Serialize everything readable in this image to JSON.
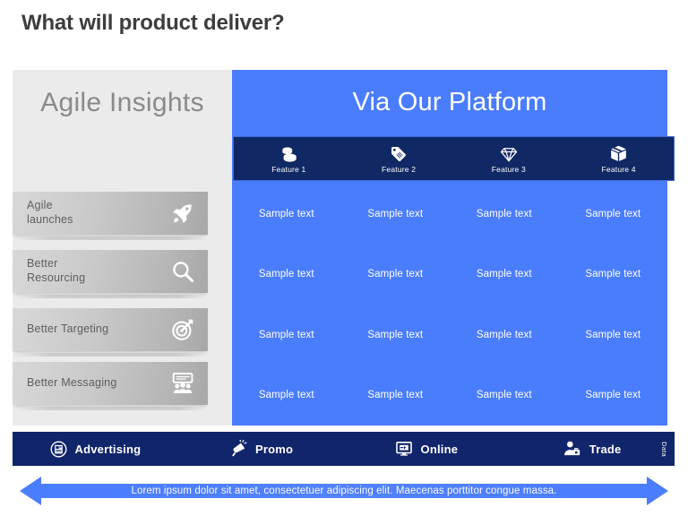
{
  "slide": {
    "title": "What will product deliver?",
    "accent_blue": "#4a7dfc",
    "navy": "#10256a",
    "panel_grey": "#ebebeb"
  },
  "left_panel": {
    "heading": "Agile Insights",
    "items": [
      {
        "label": "Agile\nlaunches",
        "line1": "Agile",
        "line2": "launches",
        "icon": "rocket-icon"
      },
      {
        "label": "Better\nResourcing",
        "line1": "Better",
        "line2": "Resourcing",
        "icon": "magnifier-icon"
      },
      {
        "label": "Better Targeting",
        "line1": "Better Targeting",
        "line2": "",
        "icon": "target-icon"
      },
      {
        "label": "Better Messaging",
        "line1": "Better Messaging",
        "line2": "",
        "icon": "presentation-icon"
      }
    ]
  },
  "main": {
    "heading": "Via Our Platform",
    "features": [
      {
        "label": "Feature 1",
        "icon": "coins-icon"
      },
      {
        "label": "Feature 2",
        "icon": "price-tag-icon"
      },
      {
        "label": "Feature 3",
        "icon": "diamond-icon"
      },
      {
        "label": "Feature 4",
        "icon": "box-icon"
      }
    ],
    "cells": [
      [
        "Sample text",
        "Sample text",
        "Sample text",
        "Sample text"
      ],
      [
        "Sample text",
        "Sample text",
        "Sample text",
        "Sample text"
      ],
      [
        "Sample text",
        "Sample text",
        "Sample text",
        "Sample text"
      ],
      [
        "Sample text",
        "Sample text",
        "Sample text",
        "Sample text"
      ]
    ]
  },
  "channels": {
    "items": [
      {
        "label": "Advertising",
        "icon": "newspaper-icon"
      },
      {
        "label": "Promo",
        "icon": "megaphone-icon"
      },
      {
        "label": "Online",
        "icon": "monitor-icon"
      },
      {
        "label": "Trade",
        "icon": "trade-person-icon"
      }
    ],
    "side_label": "Data"
  },
  "footer": {
    "arrow_text": "Lorem ipsum dolor sit amet, consectetuer adipiscing elit. Maecenas porttitor congue massa."
  }
}
